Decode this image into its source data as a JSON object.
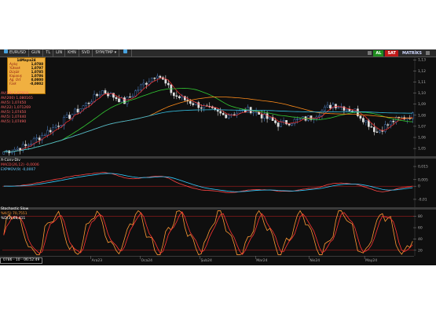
{
  "toolbar": {
    "symbol": "EURUSD",
    "items": [
      "GUN",
      "TL",
      "LIN",
      "KHN",
      "SVD",
      "SYM/TMP"
    ],
    "al_label": "AL",
    "sat_label": "SAT",
    "matriks_label": "MATRİKS"
  },
  "info_box": {
    "date": "14Mayıs24",
    "rows": [
      {
        "label": "Açılış",
        "value": "1,0788"
      },
      {
        "label": "Yüksek",
        "value": "1,0797"
      },
      {
        "label": "Düşük",
        "value": "1,0785"
      },
      {
        "label": "Kapanış",
        "value": "1,0786"
      },
      {
        "label": "Ağ. Ort",
        "value": "0,0000"
      },
      {
        "label": "Fark",
        "value": "-0,0002"
      }
    ]
  },
  "price_pane": {
    "ma_labels": [
      {
        "text": "AV(54)   1,07918",
        "color": "#ff6666"
      },
      {
        "text": "AV(200)  1,080165",
        "color": "#ff6666"
      },
      {
        "text": "AV(5)    1,07450",
        "color": "#ff6666"
      },
      {
        "text": "AV(22)   1,071269",
        "color": "#ff6666"
      },
      {
        "text": "AV(5)    1,07450",
        "color": "#ff6666"
      },
      {
        "text": "AV(5)    1,07440",
        "color": "#ff6666"
      },
      {
        "text": "AV(5)    1,07490",
        "color": "#ff6666"
      }
    ],
    "y_ticks": [
      {
        "label": "1,13",
        "value": 1.13
      },
      {
        "label": "1,12",
        "value": 1.12
      },
      {
        "label": "1,11",
        "value": 1.11
      },
      {
        "label": "1,10",
        "value": 1.1
      },
      {
        "label": "1,09",
        "value": 1.09
      },
      {
        "label": "1,08",
        "value": 1.08
      },
      {
        "label": "1,07",
        "value": 1.07
      },
      {
        "label": "1,06",
        "value": 1.06
      },
      {
        "label": "1,05",
        "value": 1.05
      }
    ],
    "y_range": [
      1.043,
      1.133
    ]
  },
  "macd_pane": {
    "title": "A-Conv-Div",
    "labels": [
      {
        "text": "MACD(26,12)  -0,0006",
        "color": "#ff5555"
      },
      {
        "text": "EXPMOV(9)    -0,0007",
        "color": "#66ccff"
      }
    ],
    "y_ticks": [
      {
        "label": "0,015",
        "value": 0.015
      },
      {
        "label": "0,005",
        "value": 0.005
      },
      {
        "label": "0",
        "value": 0
      },
      {
        "label": "-0,01",
        "value": -0.01
      }
    ],
    "y_range": [
      -0.016,
      0.021
    ]
  },
  "stoch_pane": {
    "title": "Stochastic Slow",
    "labels": [
      {
        "text": "%K(5)   70,7551",
        "color": "#ff9933"
      },
      {
        "text": "%D(3)   68,411",
        "color": "#ffffff"
      }
    ],
    "y_ticks": [
      {
        "label": "80",
        "value": 80
      },
      {
        "label": "60",
        "value": 60
      },
      {
        "label": "40",
        "value": 40
      },
      {
        "label": "20",
        "value": 20
      }
    ],
    "y_range": [
      10,
      92
    ]
  },
  "x_labels": [
    "Ara23",
    "Oca24",
    "Şub24",
    "Mar24",
    "Nis24",
    "May24"
  ],
  "time_readout": "0786 - 10 - 06:52:49",
  "colors": {
    "candle_up": "#4f7fbf",
    "candle_down": "#e0e0e0",
    "ma_red": "#ff3333",
    "ma_green": "#33cc33",
    "ma_orange": "#ff8c1a",
    "ma_cyan": "#33bbdd",
    "stoch_k": "#ff9933",
    "stoch_d": "#ff3333",
    "axis_text": "#aaaaaa",
    "level_line": "#cc2222"
  }
}
